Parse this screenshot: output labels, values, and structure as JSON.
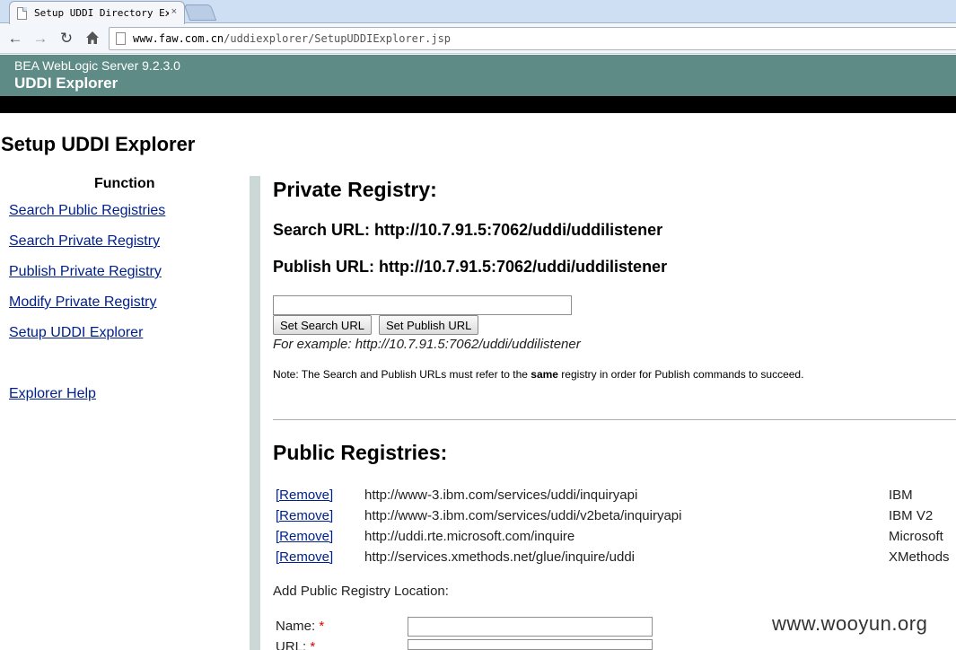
{
  "browser": {
    "tab_title": "Setup UDDI Directory Ex",
    "tab_close": "×",
    "url_host": "www.faw.com.cn",
    "url_path": "/uddiexplorer/SetupUDDIExplorer.jsp"
  },
  "header": {
    "product": "BEA WebLogic Server 9.2.3.0",
    "app": "UDDI Explorer"
  },
  "page_title": "Setup UDDI Explorer",
  "nav": {
    "heading": "Function",
    "items": [
      "Search Public Registries",
      "Search Private Registry",
      "Publish Private Registry",
      "Modify Private Registry",
      "Setup UDDI Explorer"
    ],
    "help": "Explorer Help"
  },
  "private_registry": {
    "heading": "Private Registry:",
    "search_url": "Search URL: http://10.7.91.5:7062/uddi/uddilistener",
    "publish_url": "Publish URL: http://10.7.91.5:7062/uddi/uddilistener",
    "input_value": "",
    "set_search_button": "Set Search URL",
    "set_publish_button": "Set Publish URL",
    "example": "For example: http://10.7.91.5:7062/uddi/uddilistener",
    "note_before": "Note: The Search and Publish URLs must refer to the ",
    "note_bold": "same",
    "note_after": " registry in order for Publish commands to succeed."
  },
  "public_registries": {
    "heading": "Public Registries:",
    "rows": [
      {
        "remove": "[Remove]",
        "url": "http://www-3.ibm.com/services/uddi/inquiryapi",
        "name": "IBM"
      },
      {
        "remove": "[Remove]",
        "url": "http://www-3.ibm.com/services/uddi/v2beta/inquiryapi",
        "name": "IBM V2"
      },
      {
        "remove": "[Remove]",
        "url": "http://uddi.rte.microsoft.com/inquire",
        "name": "Microsoft"
      },
      {
        "remove": "[Remove]",
        "url": "http://services.xmethods.net/glue/inquire/uddi",
        "name": "XMethods"
      }
    ],
    "add_label": "Add Public Registry Location:",
    "name_label": "Name: ",
    "url_label": "URL: ",
    "required_mark": "*"
  },
  "watermark": "www.wooyun.org"
}
